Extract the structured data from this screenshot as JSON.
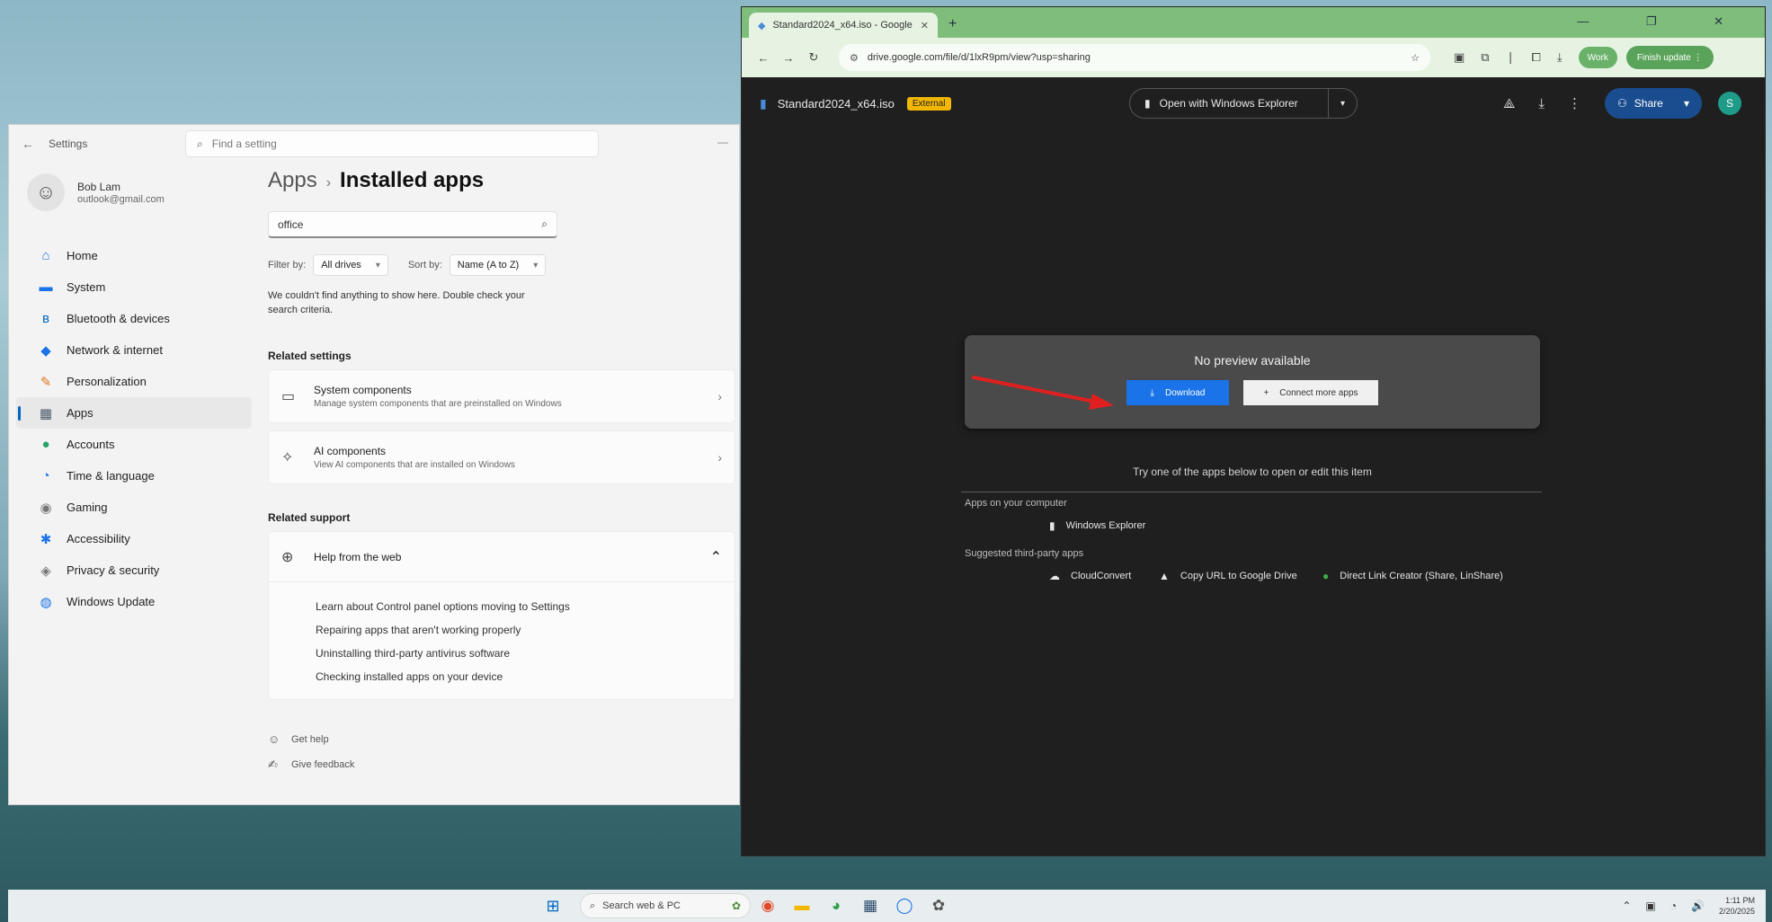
{
  "settings": {
    "titlebar": {
      "back": "←",
      "title": "Settings",
      "find_placeholder": "Find a setting",
      "controls": "—"
    },
    "profile": {
      "name": "Bob Lam",
      "email": "outlook@gmail.com"
    },
    "nav": [
      {
        "icon": "⌂",
        "label": "Home",
        "color": "#2e7ad1"
      },
      {
        "icon": "▬",
        "label": "System",
        "color": "#1a73e8"
      },
      {
        "icon": "ʙ",
        "label": "Bluetooth & devices",
        "color": "#0067c0"
      },
      {
        "icon": "◆",
        "label": "Network & internet",
        "color": "#1a73e8"
      },
      {
        "icon": "✎",
        "label": "Personalization",
        "color": "#e0731a"
      },
      {
        "icon": "▦",
        "label": "Apps",
        "color": "#4a5a6a"
      },
      {
        "icon": "●",
        "label": "Accounts",
        "color": "#2aa36a"
      },
      {
        "icon": "◔",
        "label": "Time & language",
        "color": "#1a73e8"
      },
      {
        "icon": "◉",
        "label": "Gaming",
        "color": "#777777"
      },
      {
        "icon": "✱",
        "label": "Accessibility",
        "color": "#1a73e8"
      },
      {
        "icon": "◈",
        "label": "Privacy & security",
        "color": "#777777"
      },
      {
        "icon": "◍",
        "label": "Windows Update",
        "color": "#1a73e8"
      }
    ],
    "breadcrumb": {
      "parent": "Apps",
      "separator": "›",
      "current": "Installed apps"
    },
    "search": {
      "value": "office",
      "icon": "⌕"
    },
    "filter": {
      "filter_label": "Filter by:",
      "filter_value": "All drives",
      "sort_label": "Sort by:",
      "sort_value": "Name (A to Z)"
    },
    "empty_message": "We couldn't find anything to show here. Double check your search criteria.",
    "related_settings": {
      "heading": "Related settings",
      "items": [
        {
          "icon": "▭",
          "title": "System components",
          "desc": "Manage system components that are preinstalled on Windows"
        },
        {
          "icon": "✧",
          "title": "AI components",
          "desc": "View AI components that are installed on Windows"
        }
      ]
    },
    "related_support": {
      "heading": "Related support",
      "head_title": "Help from the web",
      "links": [
        "Learn about Control panel options moving to Settings",
        "Repairing apps that aren't working properly",
        "Uninstalling third-party antivirus software",
        "Checking installed apps on your device"
      ]
    },
    "footer": [
      {
        "icon": "☺",
        "label": "Get help"
      },
      {
        "icon": "✍",
        "label": "Give feedback"
      }
    ]
  },
  "browser": {
    "tab": {
      "title": "Standard2024_x64.iso - Google",
      "close": "✕"
    },
    "new_tab": "+",
    "window_controls": "— ❐ ✕",
    "toolbar": {
      "back": "←",
      "forward": "→",
      "reload": "↻",
      "url": "drive.google.com/file/d/1lxR9pm/view?usp=sharing",
      "star": "☆",
      "ext_icons": [
        "▣",
        "⧉",
        "❘",
        "⧠",
        "⤓"
      ],
      "profile_pill": "Work",
      "update_pill": "Finish update ⋮"
    }
  },
  "drive": {
    "file_name": "Standard2024_x64.iso",
    "badge": "External",
    "open_with": "Open with Windows Explorer",
    "open_with_drop": "▾",
    "actions": {
      "add_shortcut": "⟁",
      "download": "⤓",
      "more": "⋮"
    },
    "share": {
      "label": "Share",
      "drop": "▾"
    },
    "avatar": "S",
    "no_preview": "No preview available",
    "download_label": "Download",
    "connect_label": "Connect more apps",
    "try_line": "Try one of the apps below to open or edit this item",
    "apps_on_computer": "Apps on your computer",
    "computer_app": "Windows Explorer",
    "suggested_apps": "Suggested third-party apps",
    "third_party": [
      "CloudConvert",
      "Copy URL to Google Drive",
      "Direct Link Creator (Share, LinShare)"
    ]
  },
  "taskbar": {
    "search_placeholder": "Search web & PC",
    "apps": [
      "◉",
      "▬",
      "◕",
      "▦",
      "◯",
      "✿"
    ],
    "tray": [
      "⌃",
      "▣",
      "◔",
      "🔊"
    ],
    "time": "1:11 PM",
    "date": "2/20/2025"
  }
}
